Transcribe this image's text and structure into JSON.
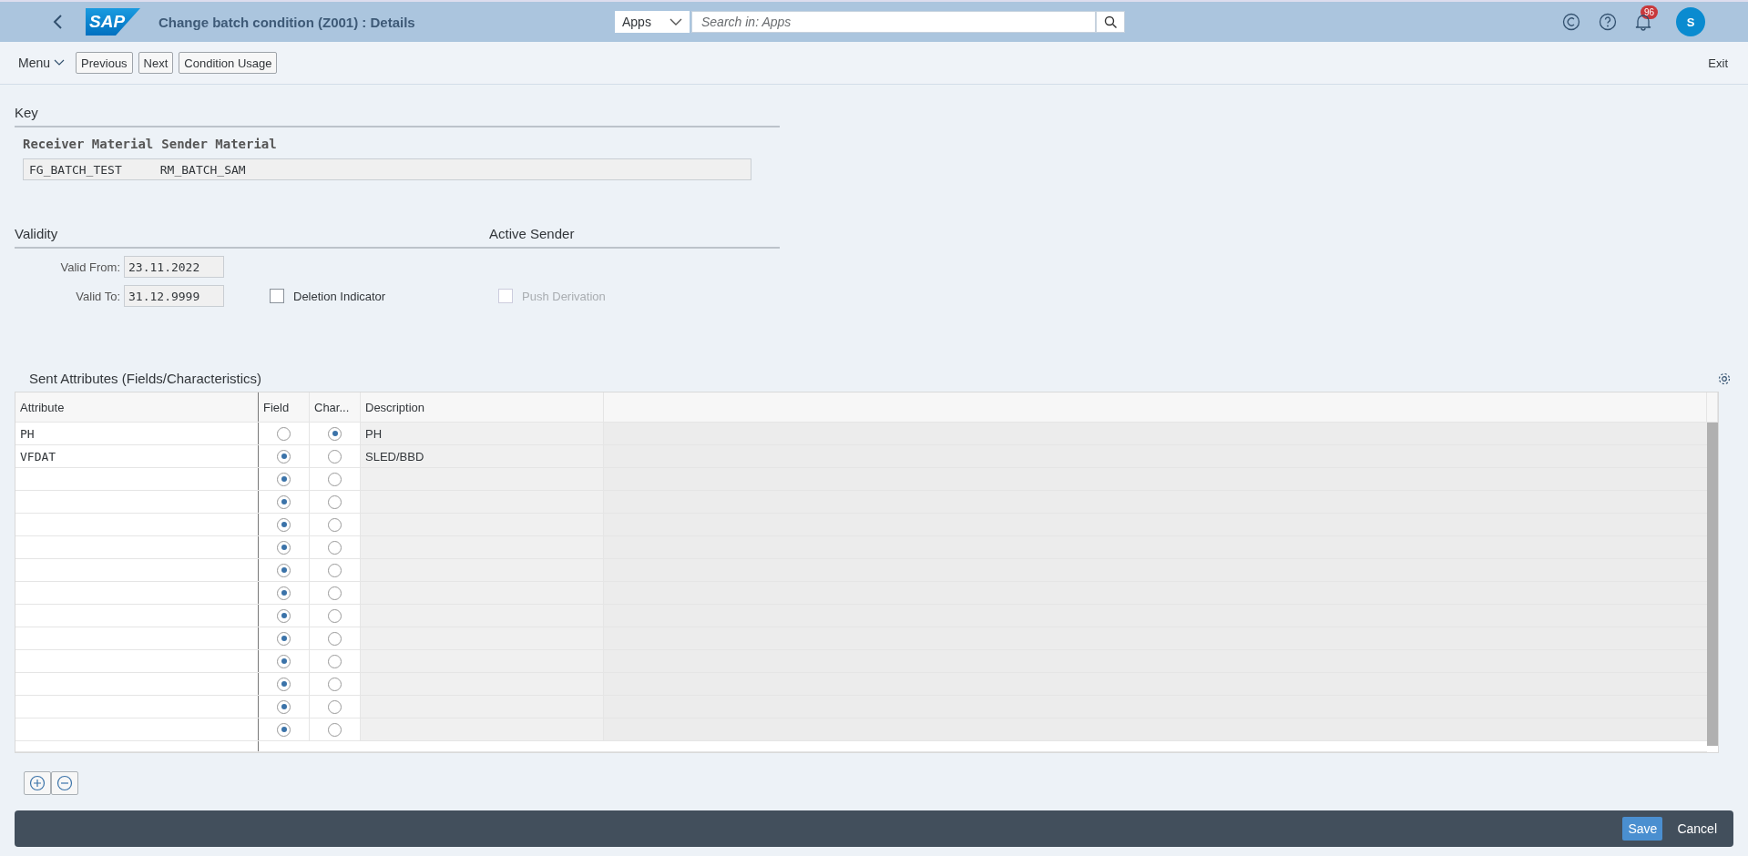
{
  "header": {
    "logo": "SAP",
    "title": "Change batch condition (Z001) : Details",
    "search_scope": "Apps",
    "search": {
      "placeholder": "Search in: Apps"
    },
    "notification_count": "96",
    "avatar": "S"
  },
  "toolbar": {
    "menu": "Menu",
    "buttons": [
      "Previous",
      "Next",
      "Condition Usage"
    ],
    "exit": "Exit"
  },
  "key": {
    "title": "Key",
    "columns": [
      "Receiver Material",
      "Sender Material"
    ],
    "values": [
      "FG_BATCH_TEST",
      "RM_BATCH_SAM"
    ]
  },
  "validity": {
    "title": "Validity",
    "valid_from_label": "Valid From:",
    "valid_from": "23.11.2022",
    "valid_to_label": "Valid To:",
    "valid_to": "31.12.9999",
    "deletion_indicator": {
      "label": "Deletion Indicator",
      "checked": false,
      "disabled": false
    }
  },
  "active_sender": {
    "title": "Active Sender",
    "push_derivation": {
      "label": "Push Derivation",
      "checked": false,
      "disabled": true
    }
  },
  "table": {
    "title": "Sent Attributes (Fields/Characteristics)",
    "columns": [
      "Attribute",
      "Field",
      "Char...",
      "Description"
    ],
    "rows": [
      {
        "attribute": "PH",
        "field": {
          "selected": false
        },
        "char": {
          "selected": true
        },
        "description": "PH"
      },
      {
        "attribute": "VFDAT",
        "field": {
          "selected": true
        },
        "char": {
          "selected": false
        },
        "description": "SLED/BBD"
      },
      {
        "field": {
          "selected": true
        },
        "char": {
          "selected": false
        }
      },
      {
        "field": {
          "selected": true
        },
        "char": {
          "selected": false
        }
      },
      {
        "field": {
          "selected": true
        },
        "char": {
          "selected": false
        }
      },
      {
        "field": {
          "selected": true
        },
        "char": {
          "selected": false
        }
      },
      {
        "field": {
          "selected": true
        },
        "char": {
          "selected": false
        }
      },
      {
        "field": {
          "selected": true
        },
        "char": {
          "selected": false
        }
      },
      {
        "field": {
          "selected": true
        },
        "char": {
          "selected": false
        }
      },
      {
        "field": {
          "selected": true
        },
        "char": {
          "selected": false
        }
      },
      {
        "field": {
          "selected": true
        },
        "char": {
          "selected": false
        }
      },
      {
        "field": {
          "selected": true
        },
        "char": {
          "selected": false
        }
      },
      {
        "field": {
          "selected": true
        },
        "char": {
          "selected": false
        }
      },
      {
        "field": {
          "selected": true
        },
        "char": {
          "selected": false
        }
      }
    ]
  },
  "footer": {
    "save": "Save",
    "cancel": "Cancel"
  }
}
